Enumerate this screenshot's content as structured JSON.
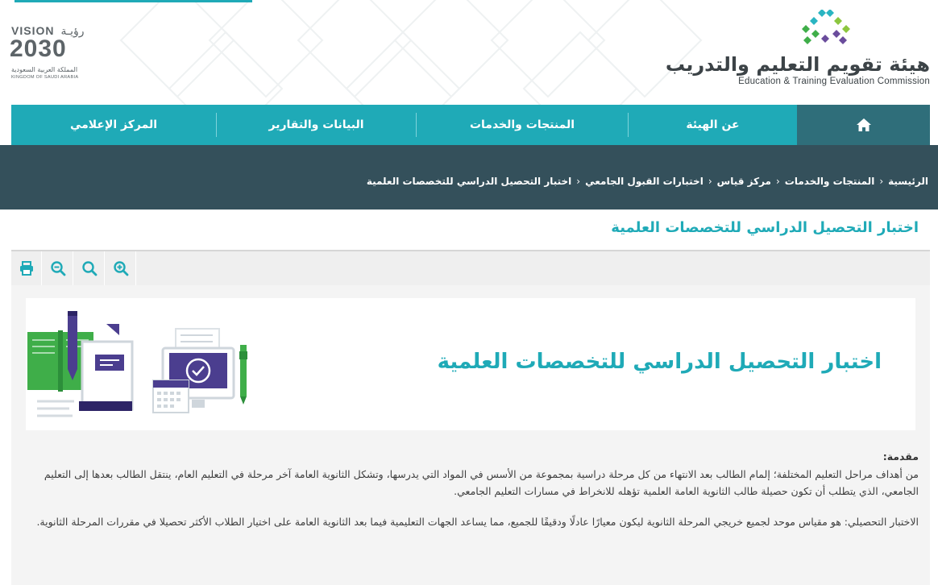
{
  "header": {
    "vision": {
      "top_en": "VISION",
      "top_ar": "رؤيـة",
      "year": "2030",
      "kingdom_ar": "المملكة العربية السعودية",
      "kingdom_en": "KINGDOM OF SAUDI ARABIA"
    },
    "logo": {
      "name_ar": "هيئة تقويم التعليم والتدريب",
      "name_en": "Education & Training Evaluation Commission",
      "colors": [
        "#2ab5c2",
        "#8cc63f",
        "#3fae49",
        "#6a4c9c"
      ]
    }
  },
  "nav": {
    "home_icon": "home-icon",
    "items": [
      {
        "label": "عن الهيئة"
      },
      {
        "label": "المنتجات والخدمات"
      },
      {
        "label": "البيانات والتقارير"
      },
      {
        "label": "المركز الإعلامي"
      }
    ]
  },
  "breadcrumb": {
    "items": [
      {
        "label": "الرئيسية"
      },
      {
        "label": "المنتجات والخدمات"
      },
      {
        "label": "مركز قياس"
      },
      {
        "label": "اختبارات القبول الجامعي"
      },
      {
        "label": "اختبار التحصيل الدراسي للتخصصات العلمية"
      }
    ],
    "separator": "‹"
  },
  "page": {
    "title": "اختبار التحصيل الدراسي للتخصصات العلمية"
  },
  "tools": {
    "icons": [
      "print-icon",
      "zoom-out-icon",
      "reset-zoom-icon",
      "zoom-in-icon"
    ]
  },
  "banner": {
    "title": "اختبار التحصيل الدراسي للتخصصات العلمية"
  },
  "content": {
    "intro_label": "مقدمة:",
    "intro_text": "من أهداف مراحل التعليم المختلفة؛ إلمام الطالب بعد الانتهاء من كل مرحلة دراسية بمجموعة من الأسس في المواد التي يدرسها، وتشكل الثانوية العامة آخر مرحلة في التعليم العام، ينتقل الطالب بعدها إلى التعليم الجامعي، الذي يتطلب أن تكون حصيلة طالب الثانوية العامة العلمية تؤهله للانخراط في مسارات التعليم الجامعي.",
    "test_text": "الاختبار التحصيلي: هو مقياس موحد لجميع خريجي المرحلة الثانوية ليكون معيارًا عادلًا ودقيقًا للجميع، مما يساعد الجهات التعليمية فيما بعد الثانوية العامة على اختيار الطلاب الأكثر تحصيلا في مقررات المرحلة الثانوية."
  },
  "colors": {
    "accent": "#1faab7",
    "nav_home": "#2f6e7a",
    "band": "#34505b",
    "text": "#3f3f3f"
  }
}
